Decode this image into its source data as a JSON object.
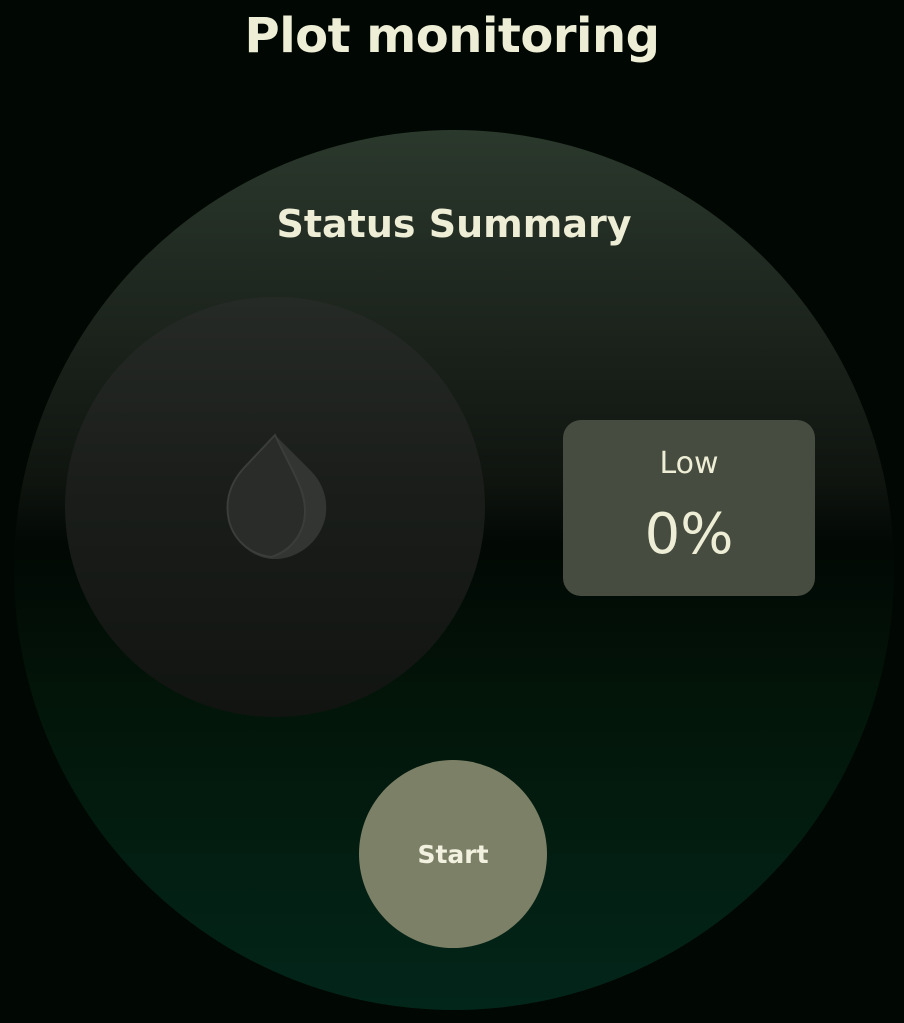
{
  "header": {
    "title": "Plot monitoring"
  },
  "summary": {
    "title": "Status Summary",
    "gauge_icon": "water-drop-icon",
    "status_label": "Low",
    "status_value": "0%",
    "level_fraction": 0
  },
  "actions": {
    "start_label": "Start"
  },
  "colors": {
    "background": "#010702",
    "text": "#eeeed6",
    "card": "#464c3f",
    "button": "#7c8066",
    "gradient_top": "#2b382c",
    "gradient_bottom": "#03261a"
  }
}
